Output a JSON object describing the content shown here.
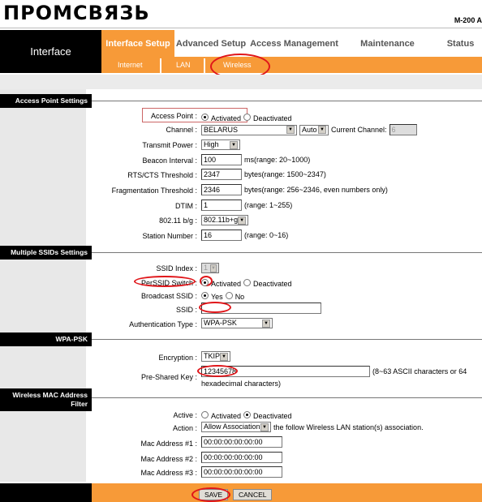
{
  "header": {
    "logo": "ПРОМСВЯЗЬ",
    "model": "M-200 A"
  },
  "nav": {
    "section": "Interface",
    "tabs": [
      {
        "label": "Interface Setup",
        "active": true
      },
      {
        "label": "Advanced Setup"
      },
      {
        "label": "Access Management"
      },
      {
        "label": "Maintenance"
      },
      {
        "label": "Status"
      }
    ],
    "subtabs": [
      {
        "label": "Internet"
      },
      {
        "label": "LAN"
      },
      {
        "label": "Wireless",
        "active": true
      }
    ]
  },
  "ap": {
    "title": "Access Point Settings",
    "access_point": {
      "label": "Access Point :",
      "options": [
        "Activated",
        "Deactivated"
      ],
      "selected": "Activated"
    },
    "channel": {
      "label": "Channel :",
      "value": "BELARUS",
      "mode": "Auto",
      "current_label": "Current Channel:",
      "current": "6"
    },
    "transmit": {
      "label": "Transmit Power :",
      "value": "High"
    },
    "beacon": {
      "label": "Beacon Interval :",
      "value": "100",
      "hint": "ms(range: 20~1000)"
    },
    "rts": {
      "label": "RTS/CTS Threshold :",
      "value": "2347",
      "hint": "bytes(range: 1500~2347)"
    },
    "frag": {
      "label": "Fragmentation Threshold :",
      "value": "2346",
      "hint": "bytes(range: 256~2346, even numbers only)"
    },
    "dtim": {
      "label": "DTIM :",
      "value": "1",
      "hint": "(range: 1~255)"
    },
    "mode": {
      "label": "802.11 b/g :",
      "value": "802.11b+g"
    },
    "station": {
      "label": "Station Number :",
      "value": "16",
      "hint": "(range: 0~16)"
    }
  },
  "ssid": {
    "title": "Multiple SSIDs Settings",
    "index": {
      "label": "SSID Index :",
      "value": "1"
    },
    "switch": {
      "label": "PerSSID Switch :",
      "options": [
        "Activated",
        "Deactivated"
      ],
      "selected": "Activated"
    },
    "broadcast": {
      "label": "Broadcast SSID :",
      "options": [
        "Yes",
        "No"
      ],
      "selected": "Yes"
    },
    "ssid": {
      "label": "SSID :",
      "value": ""
    },
    "auth": {
      "label": "Authentication Type :",
      "value": "WPA-PSK"
    }
  },
  "wpa": {
    "title": "WPA-PSK",
    "enc": {
      "label": "Encryption :",
      "value": "TKIP"
    },
    "psk": {
      "label": "Pre-Shared Key :",
      "value": "12345678",
      "hint": "(8~63 ASCII characters or 64",
      "hint2": "hexadecimal characters)"
    }
  },
  "mac": {
    "title": "Wireless MAC Address Filter",
    "active": {
      "label": "Active :",
      "options": [
        "Activated",
        "Deactivated"
      ],
      "selected": "Deactivated"
    },
    "action": {
      "label": "Action :",
      "value": "Allow Association",
      "hint": "the follow Wireless LAN station(s) association."
    },
    "addresses": [
      {
        "label": "Mac Address #1 :",
        "value": "00:00:00:00:00:00"
      },
      {
        "label": "Mac Address #2 :",
        "value": "00:00:00:00:00:00"
      },
      {
        "label": "Mac Address #3 :",
        "value": "00:00:00:00:00:00"
      }
    ]
  },
  "footer": {
    "save": "SAVE",
    "cancel": "CANCEL"
  },
  "colors": {
    "accent": "#f79a38",
    "annotation": "#e0161a"
  }
}
